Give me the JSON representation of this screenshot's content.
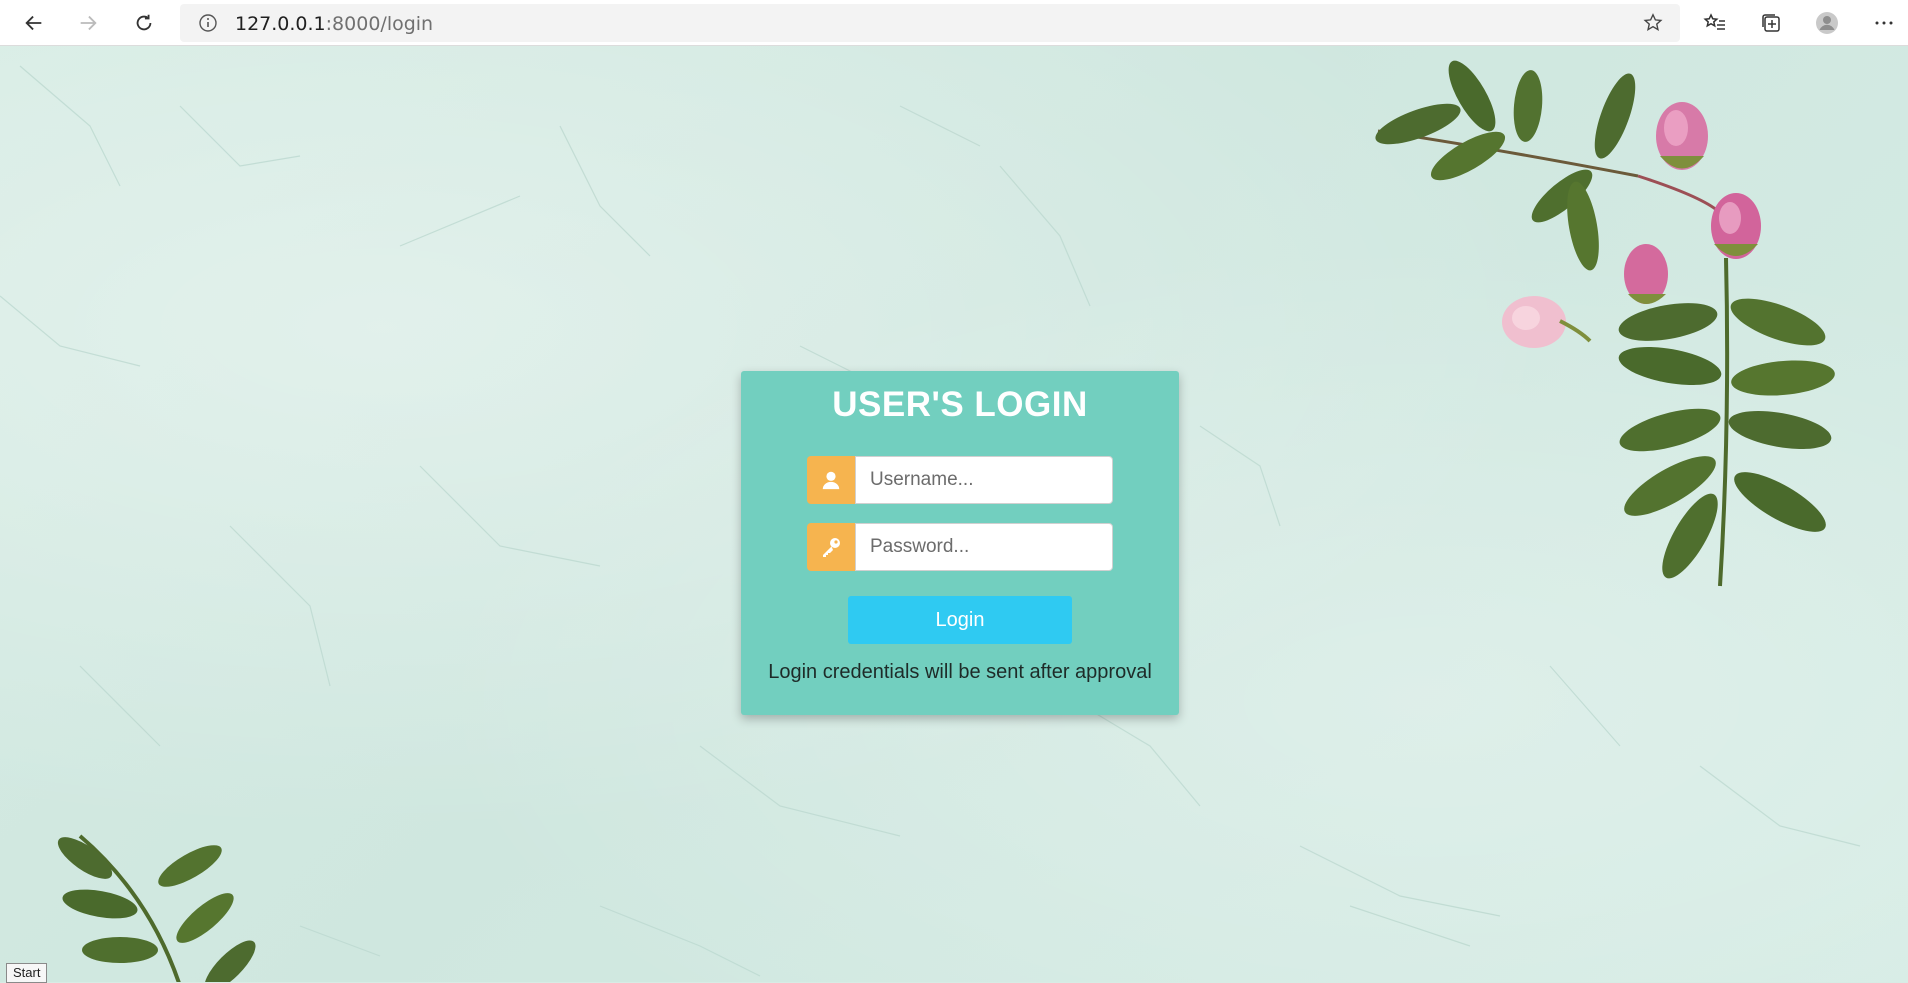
{
  "browser": {
    "url_host": "127.0.0.1",
    "url_path": ":8000/login"
  },
  "login": {
    "title": "USER'S LOGIN",
    "username_placeholder": "Username...",
    "password_placeholder": "Password...",
    "button_label": "Login",
    "note": "Login credentials will be sent after approval"
  },
  "overlay": {
    "start_label": "Start"
  },
  "colors": {
    "card": "#72cfbf",
    "icon_bg": "#f6b44f",
    "button": "#2fcaf2",
    "background": "#d8ece5"
  }
}
